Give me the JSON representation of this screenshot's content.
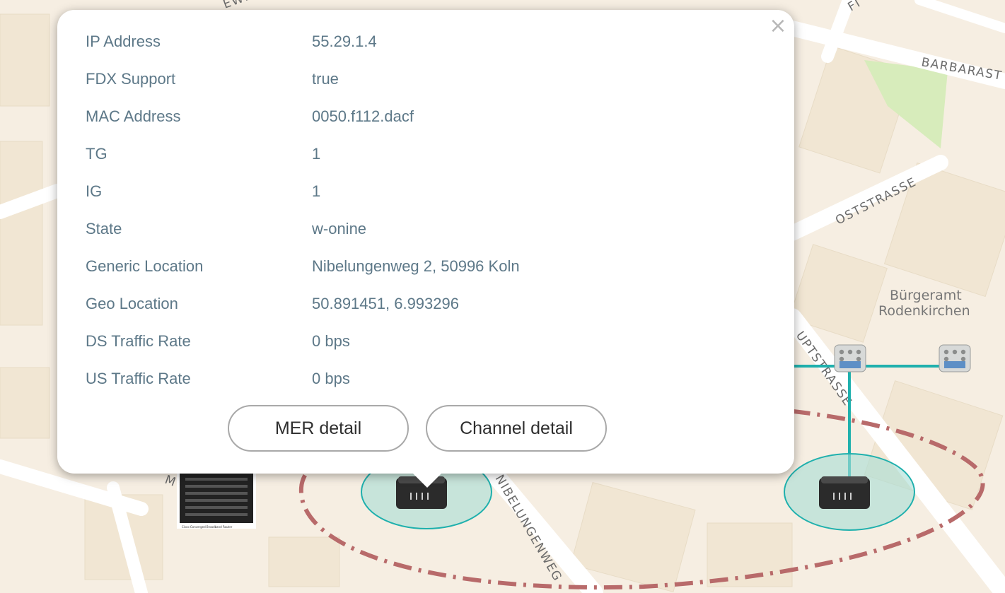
{
  "map": {
    "street_labels": [
      "BARBARAST",
      "OSTSTRASSE",
      "NIBELUNGENWEG",
      "UPTSTRASSE",
      "FI",
      "EWL",
      "M"
    ],
    "poi_label_line1": "Bürgeramt",
    "poi_label_line2": "Rodenkirchen",
    "colors": {
      "background": "#f6eee2",
      "link": "#1fb0ad",
      "group_boundary": "#b86a6a",
      "modem_halo": "#a9ddd6"
    }
  },
  "popup": {
    "rows": [
      {
        "label": "IP Address",
        "value": "55.29.1.4"
      },
      {
        "label": "FDX Support",
        "value": "true"
      },
      {
        "label": "MAC Address",
        "value": "0050.f112.dacf"
      },
      {
        "label": "TG",
        "value": "1"
      },
      {
        "label": "IG",
        "value": "1"
      },
      {
        "label": "State",
        "value": "w-onine"
      },
      {
        "label": "Generic Location",
        "value": "Nibelungenweg 2, 50996 Koln"
      },
      {
        "label": "Geo Location",
        "value": "50.891451, 6.993296"
      },
      {
        "label": "DS Traffic Rate",
        "value": "0 bps"
      },
      {
        "label": "US Traffic Rate",
        "value": "0 bps"
      }
    ],
    "close_icon": "×",
    "buttons": {
      "mer": "MER detail",
      "channel": "Channel detail"
    }
  },
  "devices": {
    "router_caption": "Cisco Converged Broadband Router"
  }
}
